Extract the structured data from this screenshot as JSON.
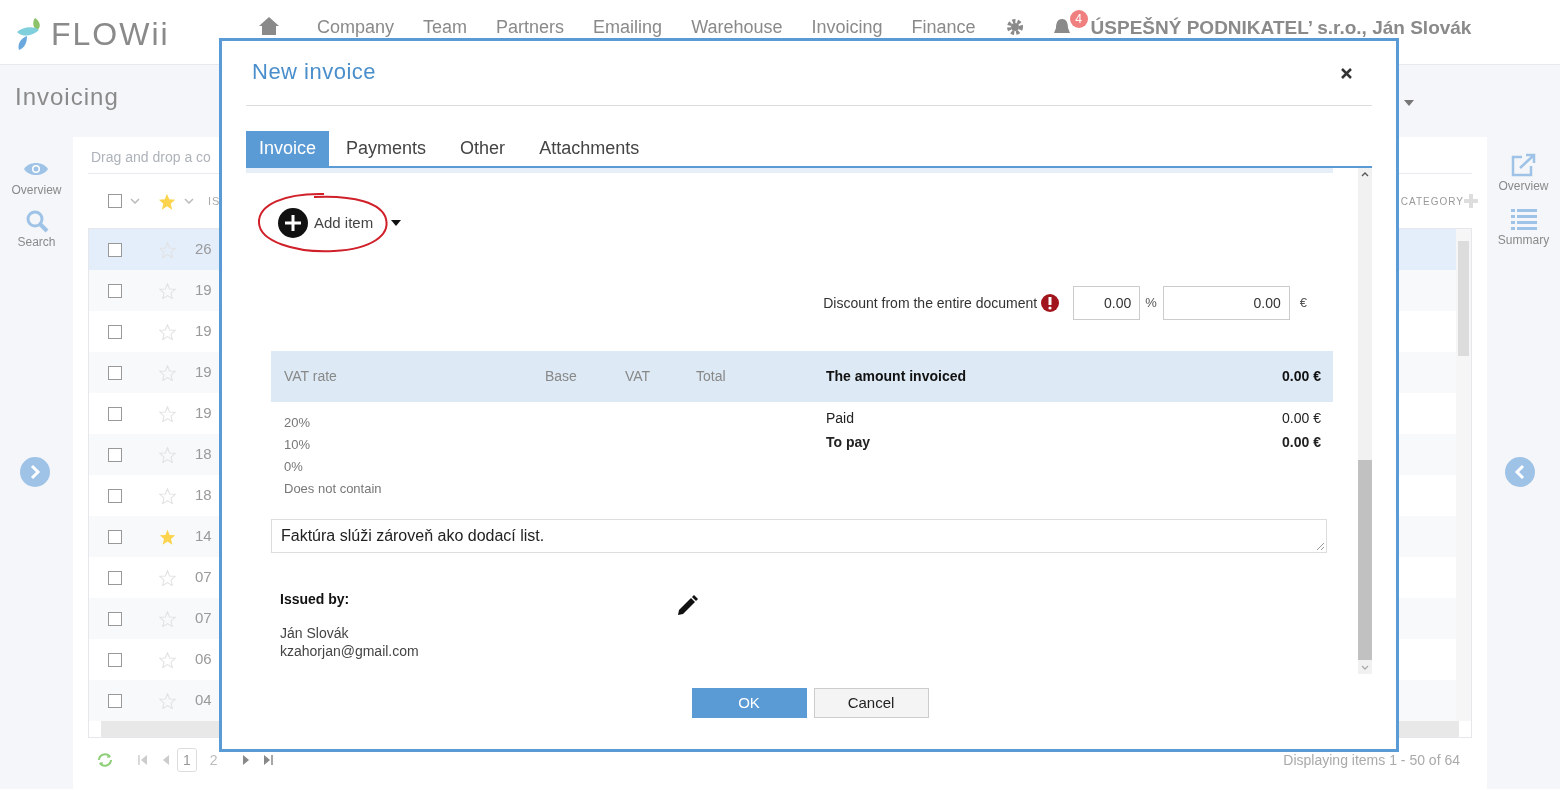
{
  "app": {
    "logo": "FLOWii",
    "nav": [
      {
        "label": "Company"
      },
      {
        "label": "Team"
      },
      {
        "label": "Partners"
      },
      {
        "label": "Emailing"
      },
      {
        "label": "Warehouse"
      },
      {
        "label": "Invoicing"
      },
      {
        "label": "Finance"
      }
    ],
    "notification_count": "4",
    "account": "ÚSPEŠNÝ PODNIKATEL’ s.r.o., Ján Slovák"
  },
  "page": {
    "title": "Invoicing"
  },
  "left_sidebar": [
    {
      "kind": "overview",
      "label": "Overview"
    },
    {
      "kind": "search",
      "label": "Search"
    }
  ],
  "right_sidebar": [
    {
      "kind": "overview",
      "label": "Overview"
    },
    {
      "kind": "summary",
      "label": "Summary"
    }
  ],
  "grid": {
    "group_placeholder": "Drag and drop a co",
    "header": {
      "checked": false,
      "column_3": "IS",
      "category": "CATEGORY"
    },
    "rows": [
      {
        "column_3": "26",
        "checked": false,
        "starred": false,
        "selected": true
      },
      {
        "column_3": "19",
        "checked": false,
        "starred": false,
        "selected": false
      },
      {
        "column_3": "19",
        "checked": false,
        "starred": false,
        "selected": false
      },
      {
        "column_3": "19",
        "checked": false,
        "starred": false,
        "selected": false
      },
      {
        "column_3": "19",
        "checked": false,
        "starred": false,
        "selected": false
      },
      {
        "column_3": "18",
        "checked": false,
        "starred": false,
        "selected": false
      },
      {
        "column_3": "18",
        "checked": false,
        "starred": false,
        "selected": false
      },
      {
        "column_3": "14",
        "checked": false,
        "starred": true,
        "selected": false
      },
      {
        "column_3": "07",
        "checked": false,
        "starred": false,
        "selected": false
      },
      {
        "column_3": "07",
        "checked": false,
        "starred": false,
        "selected": false
      },
      {
        "column_3": "06",
        "checked": false,
        "starred": false,
        "selected": false
      },
      {
        "column_3": "04",
        "checked": false,
        "starred": false,
        "selected": false
      }
    ]
  },
  "pagination": {
    "pages": [
      {
        "label": "1",
        "selected": true
      },
      {
        "label": "2",
        "selected": false
      }
    ],
    "info": "Displaying items 1 - 50 of 64"
  },
  "dialog": {
    "title": "New invoice",
    "tabs": [
      {
        "label": "Invoice",
        "selected": true
      },
      {
        "label": "Payments",
        "selected": false
      },
      {
        "label": "Other",
        "selected": false
      },
      {
        "label": "Attachments",
        "selected": false
      }
    ],
    "add_item": "Add item",
    "discount": {
      "label": "Discount from the entire document",
      "percent": "0.00",
      "percent_unit": "%",
      "amount": "0.00",
      "currency": "€"
    },
    "vat_table": {
      "columns": [
        "VAT rate",
        "Base",
        "VAT",
        "Total"
      ],
      "rates": [
        "20%",
        "10%",
        "0%",
        "Does not contain"
      ]
    },
    "invoiced": {
      "label": "The amount invoiced",
      "value": "0.00 €"
    },
    "totals": [
      {
        "label": "Paid",
        "value": "0.00 €",
        "bold": false
      },
      {
        "label": "To pay",
        "value": "0.00 €",
        "bold": true
      }
    ],
    "note": "Faktúra slúži zároveň ako dodací list.",
    "issued_by": {
      "label": "Issued by:",
      "name": "Ján Slovák",
      "email": "kzahorjan@gmail.com"
    },
    "buttons": [
      {
        "label": "OK",
        "kind": "primary"
      },
      {
        "label": "Cancel",
        "kind": "secondary"
      }
    ]
  }
}
